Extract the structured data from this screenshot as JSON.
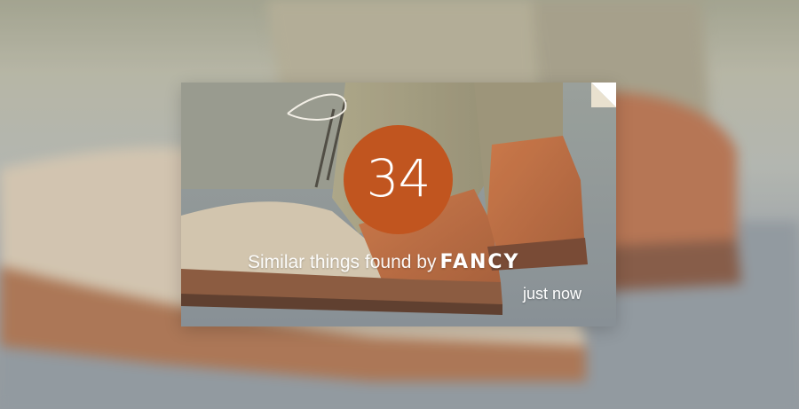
{
  "notification": {
    "count": "34",
    "message": "Similar things found by",
    "brand": "FANCY",
    "time": "just now"
  },
  "colors": {
    "badge": "#c1551f",
    "text": "#ffffff"
  },
  "icons": [
    "page-corner-icon"
  ]
}
